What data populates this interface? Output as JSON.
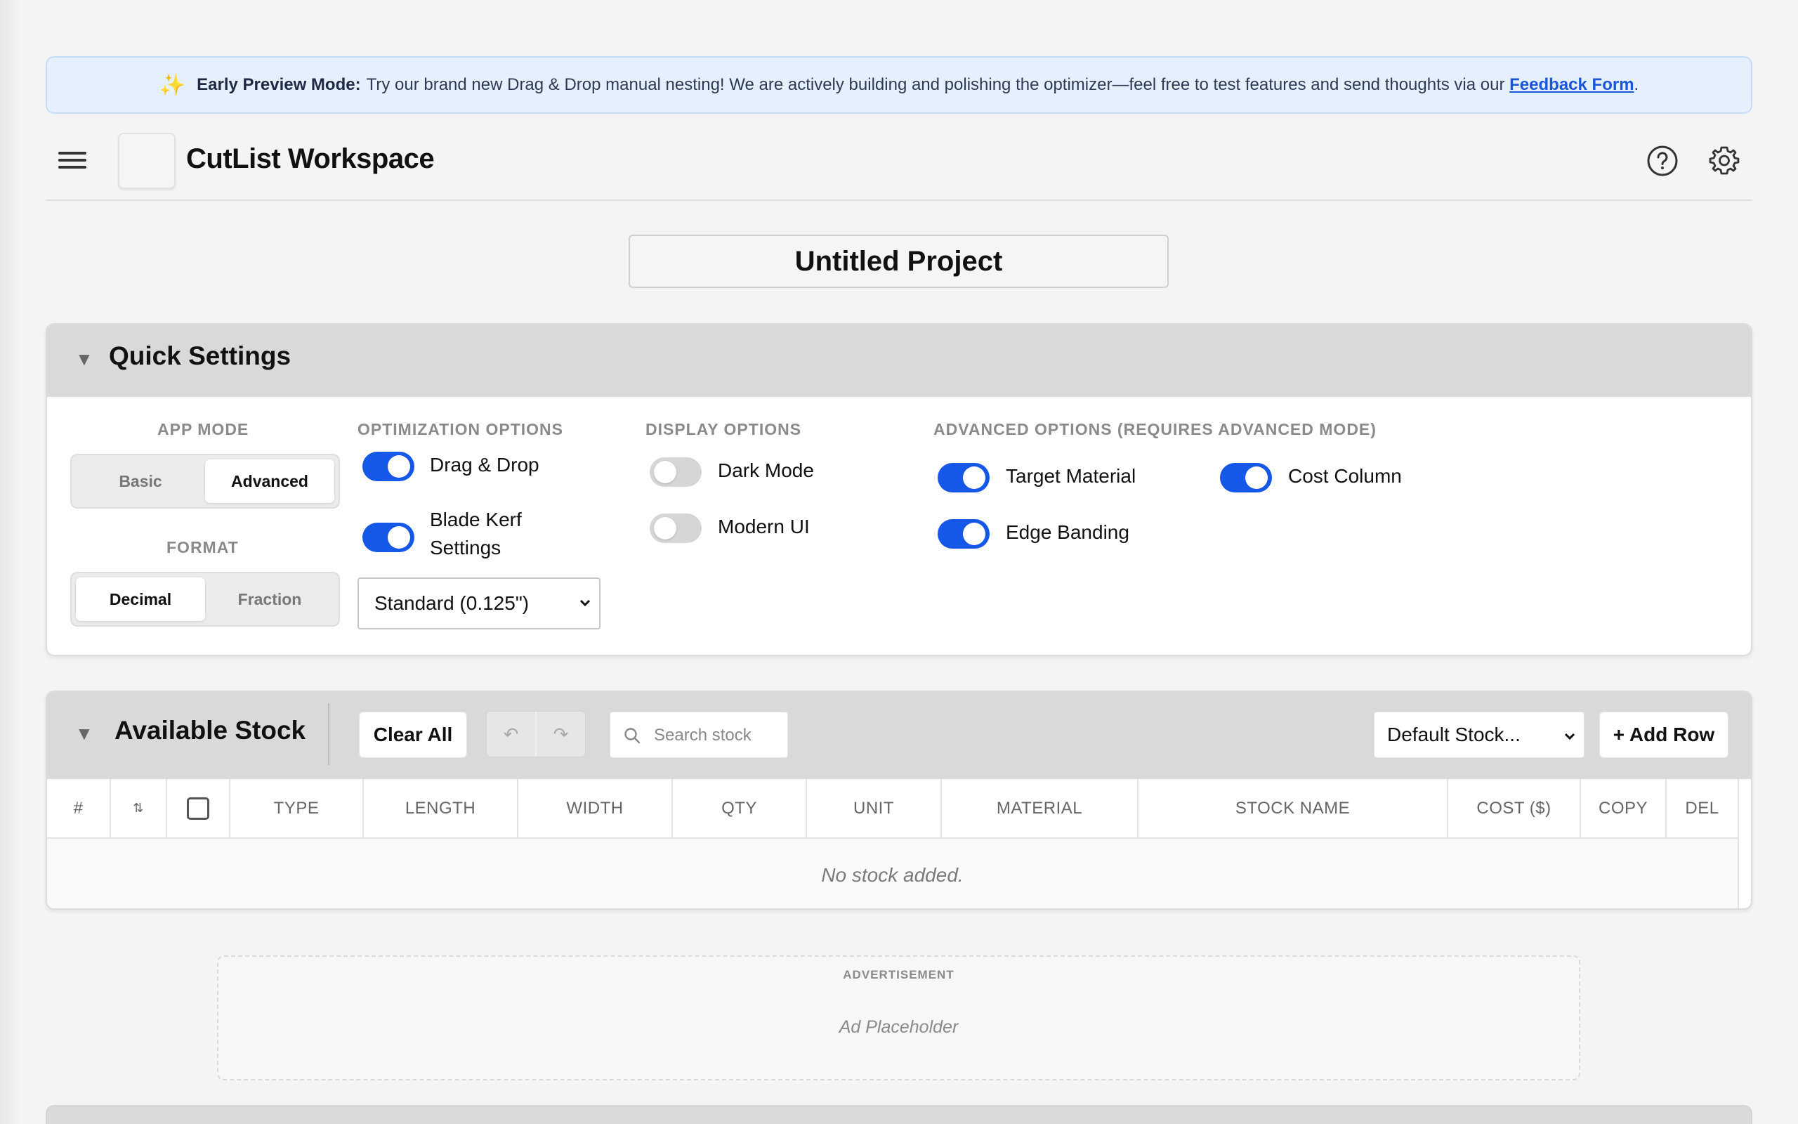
{
  "banner": {
    "title": "Early Preview Mode:",
    "text": "Try our brand new Drag & Drop manual nesting! We are actively building and polishing the optimizer—feel free to test features and send thoughts via our",
    "link_label": "Feedback Form",
    "trailing": "."
  },
  "header": {
    "app_title": "CutList Workspace"
  },
  "project": {
    "title": "Untitled Project"
  },
  "quick_settings": {
    "title": "Quick Settings",
    "app_mode": {
      "label": "APP MODE",
      "options": [
        "Basic",
        "Advanced"
      ],
      "selected": "Advanced"
    },
    "format": {
      "label": "FORMAT",
      "options": [
        "Decimal",
        "Fraction"
      ],
      "selected": "Decimal"
    },
    "optimization": {
      "label": "OPTIMIZATION OPTIONS",
      "drag_drop": {
        "label": "Drag & Drop",
        "on": true
      },
      "blade_kerf": {
        "label": "Blade Kerf Settings",
        "on": true
      },
      "kerf_value": "Standard (0.125\")"
    },
    "display": {
      "label": "DISPLAY OPTIONS",
      "dark_mode": {
        "label": "Dark Mode",
        "on": false
      },
      "modern_ui": {
        "label": "Modern UI",
        "on": false
      }
    },
    "advanced": {
      "label": "ADVANCED OPTIONS (REQUIRES ADVANCED MODE)",
      "target_material": {
        "label": "Target Material",
        "on": true
      },
      "edge_banding": {
        "label": "Edge Banding",
        "on": true
      },
      "cost_column": {
        "label": "Cost Column",
        "on": true
      }
    }
  },
  "stock": {
    "title": "Available Stock",
    "clear_all": "Clear All",
    "undo_icon": "↶",
    "redo_icon": "↷",
    "search_placeholder": "Search stock",
    "default_stock": "Default Stock...",
    "add_row": "+ Add Row",
    "columns": [
      "#",
      "⇅",
      "",
      "TYPE",
      "LENGTH",
      "WIDTH",
      "QTY",
      "UNIT",
      "MATERIAL",
      "STOCK NAME",
      "COST ($)",
      "COPY",
      "DEL"
    ],
    "empty_message": "No stock added."
  },
  "ad": {
    "label": "ADVERTISEMENT",
    "placeholder": "Ad Placeholder"
  },
  "colors": {
    "accent": "#1557e6",
    "panel_header": "#d9d9d9",
    "banner_bg": "#e6f0fc"
  }
}
